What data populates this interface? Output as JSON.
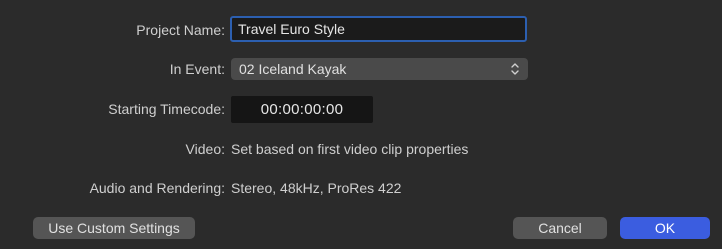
{
  "form": {
    "project_name_label": "Project Name:",
    "project_name_value": "Travel Euro Style",
    "event_label": "In Event:",
    "event_value": "02 Iceland Kayak",
    "timecode_label": "Starting Timecode:",
    "timecode_value": "00:00:00:00",
    "video_label": "Video:",
    "video_value": "Set based on first video clip properties",
    "audio_label": "Audio and Rendering:",
    "audio_value": "Stereo, 48kHz, ProRes 422"
  },
  "buttons": {
    "custom_settings": "Use Custom Settings",
    "cancel": "Cancel",
    "ok": "OK"
  },
  "icons": {
    "event_select": "chevron-up-down-icon"
  },
  "colors": {
    "background": "#2b2b2b",
    "field_focus_border": "#2c5fb0",
    "primary_button": "#3b5de0",
    "secondary_button": "#555555"
  }
}
